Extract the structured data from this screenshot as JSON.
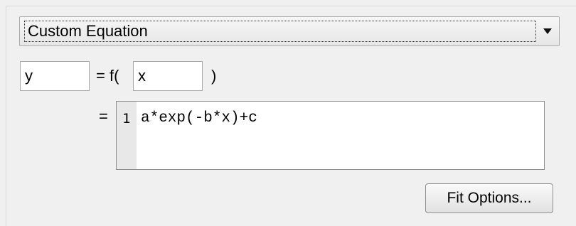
{
  "fit_type": {
    "selected": "Custom Equation",
    "icon": "chevron-down-icon"
  },
  "equation": {
    "dependent_variable": "y",
    "function_prefix": "= f(",
    "independent_variable": "x",
    "function_suffix": ")",
    "equals": "=",
    "line_number": "1",
    "expression": "a*exp(-b*x)+c"
  },
  "actions": {
    "fit_options_label": "Fit Options..."
  }
}
